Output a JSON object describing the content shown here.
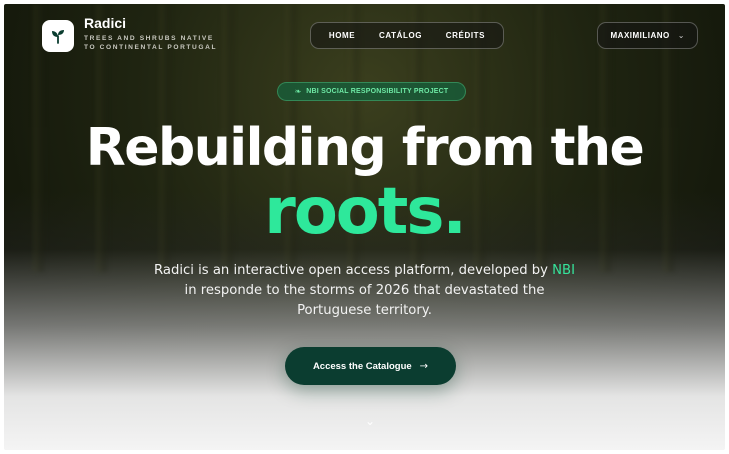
{
  "brand": {
    "name": "Radici",
    "tagline_line1": "TREES AND SHRUBS NATIVE",
    "tagline_line2": "TO CONTINENTAL PORTUGAL",
    "logo_icon": "sprout-icon"
  },
  "nav": {
    "items": [
      {
        "label": "HOME"
      },
      {
        "label": "CATÁLOG"
      },
      {
        "label": "CRÉDITS"
      }
    ]
  },
  "user": {
    "name": "MAXIMILIANO",
    "dropdown_icon": "chevron-down-icon"
  },
  "badge": {
    "text": "NBI SOCIAL RESPONSIBILITY PROJECT",
    "icon": "sprout-icon"
  },
  "hero": {
    "headline_line1": "Rebuilding from the",
    "headline_line2": "roots.",
    "description_part1": "Radici is an interactive open access platform, developed by ",
    "description_highlight": "NBI",
    "description_part2": " in responde to the storms of 2026 that devastated the Portuguese territory.",
    "cta_label": "Access the Catalogue",
    "cta_icon": "arrow-right-icon",
    "scroll_icon": "chevron-down-icon"
  },
  "colors": {
    "accent": "#2ee89b",
    "cta_bg": "#0b3d30",
    "badge_bg": "#195c38"
  }
}
